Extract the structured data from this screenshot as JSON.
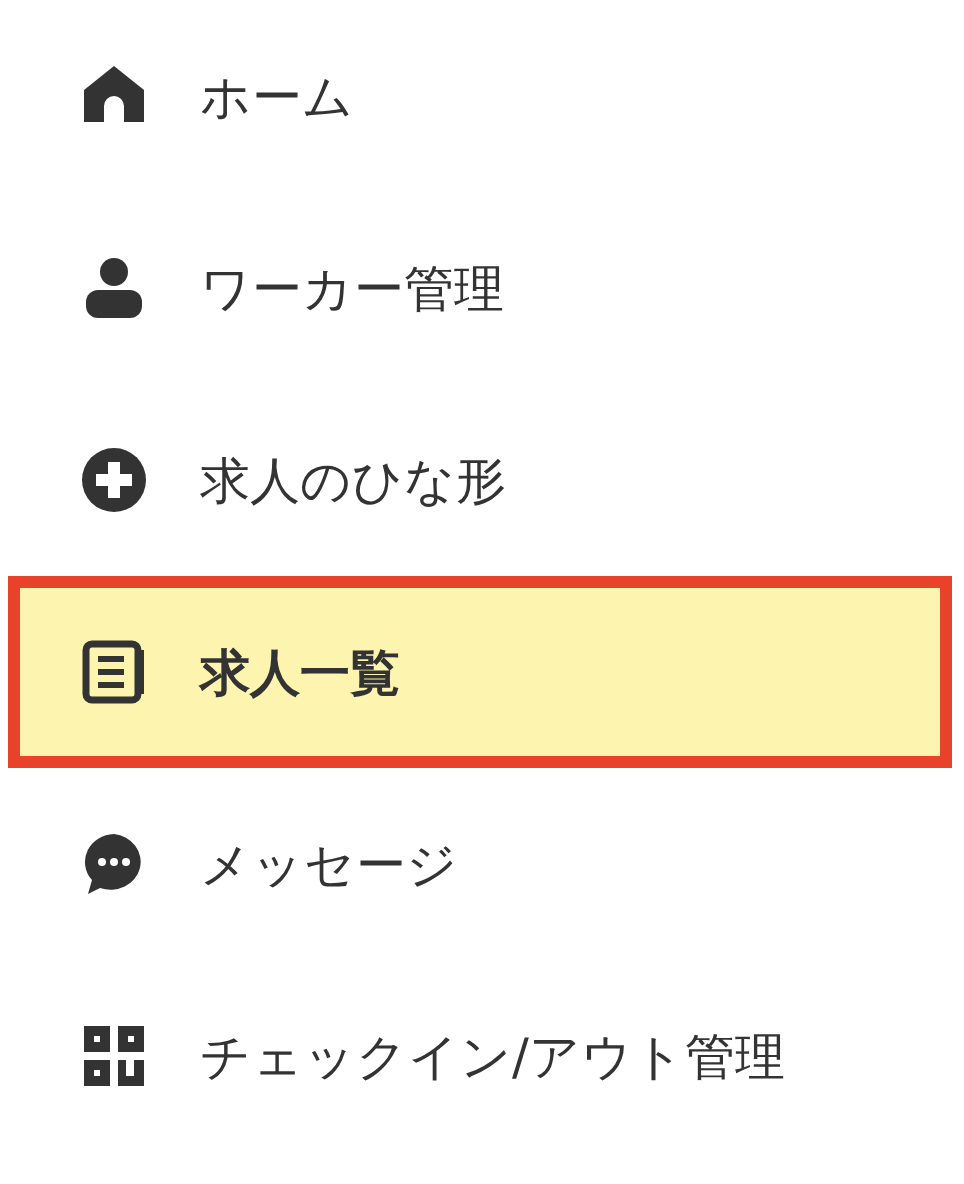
{
  "menu": {
    "items": [
      {
        "label": "ホーム",
        "selected": false
      },
      {
        "label": "ワーカー管理",
        "selected": false
      },
      {
        "label": "求人のひな形",
        "selected": false
      },
      {
        "label": "求人一覧",
        "selected": true
      },
      {
        "label": "メッセージ",
        "selected": false
      },
      {
        "label": "チェックイン/アウト管理",
        "selected": false
      }
    ]
  }
}
